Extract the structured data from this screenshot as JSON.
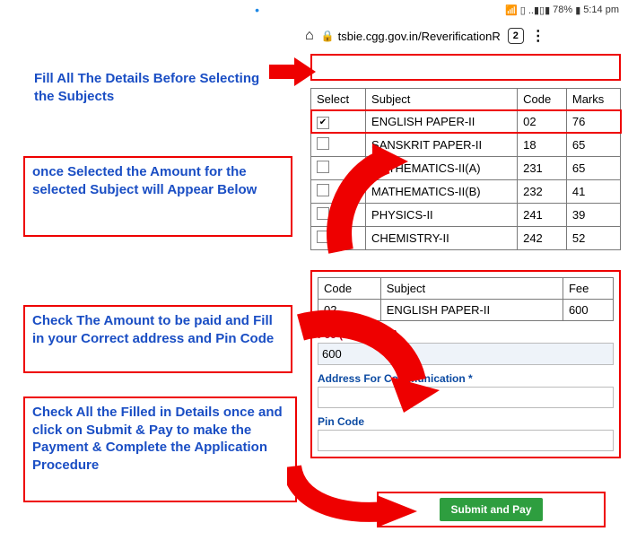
{
  "status": {
    "dot": "•",
    "signal": "📶",
    "sim": "▯ ..▮▯▮",
    "battery": "78%",
    "time": "5:14 pm"
  },
  "browser": {
    "url": "tsbie.cgg.gov.in/ReverificationR",
    "tabs": "2"
  },
  "annotations": {
    "a1": "Fill All The Details Before Selecting the Subjects",
    "a2": "once Selected the Amount for the selected Subject will Appear Below",
    "a3": "Check The Amount to  be paid and Fill in your Correct address and Pin Code",
    "a4": "Check All the Filled in Details once and click on Submit & Pay to make the Payment & Complete the Application Procedure"
  },
  "subjects": {
    "headers": {
      "select": "Select",
      "subject": "Subject",
      "code": "Code",
      "marks": "Marks"
    },
    "rows": [
      {
        "checked": true,
        "subject": "ENGLISH PAPER-II",
        "code": "02",
        "marks": "76"
      },
      {
        "checked": false,
        "subject": "SANSKRIT PAPER-II",
        "code": "18",
        "marks": "65"
      },
      {
        "checked": false,
        "subject": "MATHEMATICS-II(A)",
        "code": "231",
        "marks": "65"
      },
      {
        "checked": false,
        "subject": "MATHEMATICS-II(B)",
        "code": "232",
        "marks": "41"
      },
      {
        "checked": false,
        "subject": "PHYSICS-II",
        "code": "241",
        "marks": "39"
      },
      {
        "checked": false,
        "subject": "CHEMISTRY-II",
        "code": "242",
        "marks": "52"
      }
    ]
  },
  "fee": {
    "headers": {
      "code": "Code",
      "subject": "Subject",
      "fee": "Fee"
    },
    "row": {
      "code": "02",
      "subject": "ENGLISH PAPER-II",
      "fee": "600"
    },
    "fee_label": "Fee (in Rupees)",
    "fee_value": "600",
    "addr_label": "Address For Communication *",
    "pin_label": "Pin Code"
  },
  "submit": {
    "label": "Submit and Pay"
  }
}
